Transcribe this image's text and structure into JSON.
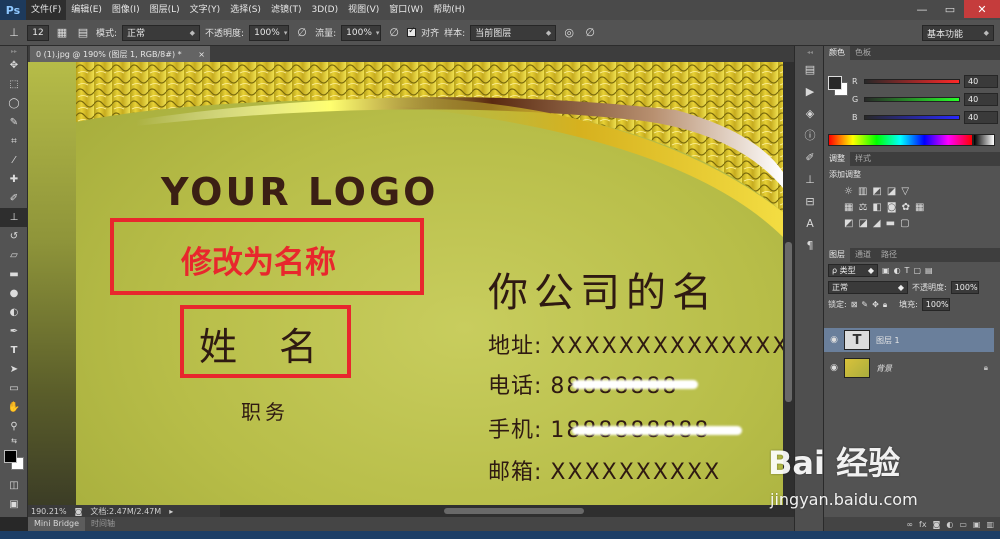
{
  "app": {
    "logo": "Ps",
    "accent": "#1d3a5c"
  },
  "menu": [
    "文件(F)",
    "编辑(E)",
    "图像(I)",
    "图层(L)",
    "文字(Y)",
    "选择(S)",
    "滤镜(T)",
    "3D(D)",
    "视图(V)",
    "窗口(W)",
    "帮助(H)"
  ],
  "window_controls": {
    "minimize": "—",
    "restore": "▭",
    "close": "✕"
  },
  "options": {
    "brush_size": "12",
    "mode_label": "模式:",
    "mode_value": "正常",
    "opacity_label": "不透明度:",
    "opacity_value": "100%",
    "flow_label": "流量:",
    "flow_value": "100%",
    "align_label": "对齐",
    "sample_label": "样本:",
    "sample_value": "当前图层",
    "workspace": "基本功能"
  },
  "document": {
    "tab_title": "0 (1).jpg @ 190% (图层 1, RGB/8#) *",
    "tab_close": "×",
    "zoom": "190.21%",
    "doc_size": "文档:2.47M/2.47M"
  },
  "bottom_tabs": [
    "Mini Bridge",
    "时间轴"
  ],
  "card": {
    "logo_text": "YOUR LOGO",
    "red_title": "修改为名称",
    "name": "姓　名",
    "position": "职务",
    "company": "你公司的名",
    "rows": [
      {
        "label": "地址:",
        "value": "XXXXXXXXXXXXXX"
      },
      {
        "label": "电话:",
        "value": "88888888"
      },
      {
        "label": "手机:",
        "value": "1888888888"
      },
      {
        "label": "邮箱:",
        "value": "XXXXXXXXXX"
      }
    ],
    "highlight_color": "#e8272d",
    "text_color": "#2f1a12"
  },
  "color_panel": {
    "tabs": [
      "颜色",
      "色板"
    ],
    "channels": [
      {
        "label": "R",
        "value": "40"
      },
      {
        "label": "G",
        "value": "40"
      },
      {
        "label": "B",
        "value": "40"
      }
    ]
  },
  "adjust_panel": {
    "tabs": [
      "调整",
      "样式"
    ],
    "title": "添加调整"
  },
  "layers_panel": {
    "tabs": [
      "图层",
      "通道",
      "路径"
    ],
    "filter_label": "ρ 类型",
    "blend_mode": "正常",
    "opacity_label": "不透明度:",
    "opacity_value": "100%",
    "lock_label": "锁定:",
    "fill_label": "填充:",
    "fill_value": "100%",
    "layers": [
      {
        "name": "图层 1",
        "type": "text",
        "selected": true
      },
      {
        "name": "背景",
        "type": "image",
        "selected": false
      }
    ]
  },
  "watermark": {
    "main": "Bai 经验",
    "url": "jingyan.baidu.com"
  }
}
